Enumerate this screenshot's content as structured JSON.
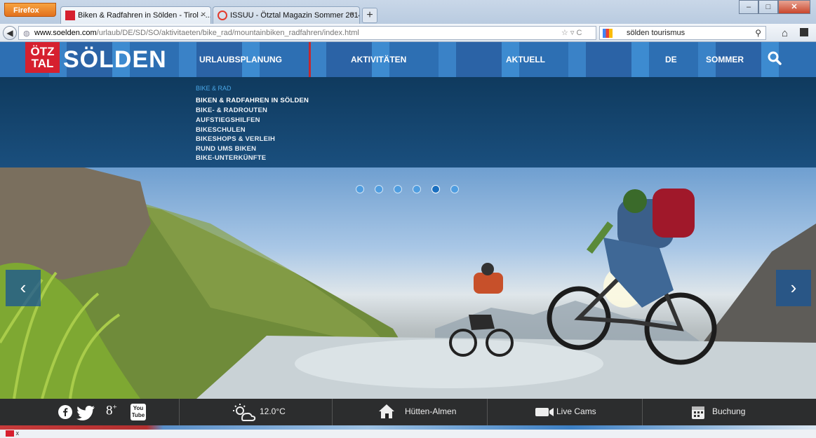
{
  "browser": {
    "menu_label": "Firefox",
    "tabs": [
      {
        "title": "Biken & Radfahren in Sölden - Tirol - ..."
      },
      {
        "title": "ISSUU - Ötztal Magazin Sommer 2014..."
      }
    ],
    "new_tab": "+",
    "url_host": "www.soelden.com",
    "url_path": "/urlaub/DE/SD/SO/aktivitaeten/bike_rad/mountainbiken_radfahren/index.html",
    "search_value": "sölden tourismus",
    "window_buttons": {
      "minimize": "–",
      "maximize": "□",
      "close": "✕"
    }
  },
  "site": {
    "logo_box": [
      "ÖTZ",
      "TAL"
    ],
    "logo_word": "SÖLDEN",
    "nav": [
      "URLAUBSPLANUNG",
      "AKTIVITÄTEN",
      "AKTUELL",
      "DE",
      "SOMMER"
    ]
  },
  "dropdown": {
    "section": "BIKE & RAD",
    "items": [
      "BIKEN & RADFAHREN IN SÖLDEN",
      "BIKE- & RADROUTEN",
      "AUFSTIEGSHILFEN",
      "BIKESCHULEN",
      "BIKESHOPS & VERLEIH",
      "RUND UMS BIKEN",
      "BIKE-UNTERKÜNFTE"
    ]
  },
  "hero": {
    "slide_count": 6,
    "active_slide": 5,
    "prev": "‹",
    "next": "›"
  },
  "bottombar": {
    "weather": "12.0°C",
    "huts": "Hütten-Almen",
    "cams": "Live Cams",
    "booking": "Buchung",
    "social": [
      "facebook",
      "twitter",
      "google-plus",
      "youtube"
    ],
    "youtube_label": [
      "You",
      "Tube"
    ]
  },
  "statusbar": {
    "text": "x"
  },
  "colors": {
    "brand_red": "#d6202f",
    "brand_blue": "#2d6fb3",
    "dropdown_bg": "#123f66"
  }
}
